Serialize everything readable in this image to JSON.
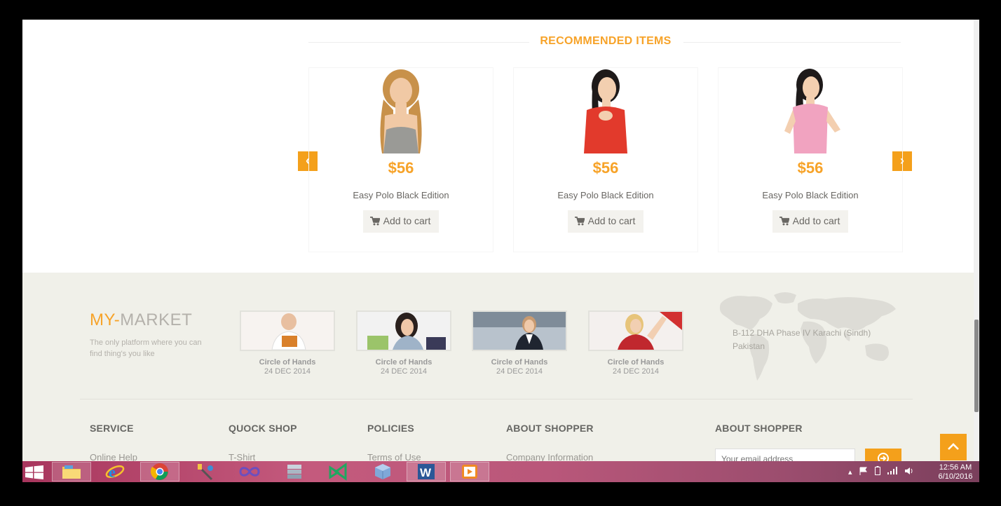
{
  "recommended": {
    "title": "RECOMMENDED ITEMS",
    "prev_label": "‹",
    "next_label": "›",
    "items": [
      {
        "price": "$56",
        "name": "Easy Polo Black Edition",
        "cart_label": "Add to cart",
        "dress_color": "#9a9a96"
      },
      {
        "price": "$56",
        "name": "Easy Polo Black Edition",
        "cart_label": "Add to cart",
        "dress_color": "#e23a2c"
      },
      {
        "price": "$56",
        "name": "Easy Polo Black Edition",
        "cart_label": "Add to cart",
        "dress_color": "#f1a3c0"
      }
    ]
  },
  "footer": {
    "logo_accent": "MY-",
    "logo_rest": "MARKET",
    "tagline": "The only platform where you can find thing's you like",
    "videos": [
      {
        "title": "Circle of Hands",
        "date": "24 DEC 2014"
      },
      {
        "title": "Circle of Hands",
        "date": "24 DEC 2014"
      },
      {
        "title": "Circle of Hands",
        "date": "24 DEC 2014"
      },
      {
        "title": "Circle of Hands",
        "date": "24 DEC 2014"
      }
    ],
    "address": "B-112 DHA Phase IV Karachi (Sindh) Pakistan",
    "columns": [
      {
        "heading": "SERVICE",
        "first_link": "Online Help"
      },
      {
        "heading": "QUOCK SHOP",
        "first_link": "T-Shirt"
      },
      {
        "heading": "POLICIES",
        "first_link": "Terms of Use"
      },
      {
        "heading": "ABOUT SHOPPER",
        "first_link": "Company Information"
      },
      {
        "heading": "ABOUT SHOPPER",
        "first_link": ""
      }
    ],
    "email_placeholder": "Your email address"
  },
  "taskbar": {
    "apps": [
      "file-explorer",
      "internet-explorer",
      "chrome",
      "paint",
      "visual-studio-infinity",
      "database-tool",
      "visual-studio",
      "virtualbox",
      "word",
      "media-player"
    ],
    "time": "12:56 AM",
    "date": "6/10/2016"
  },
  "colors": {
    "accent": "#f7a329",
    "button_orange": "#f4a01b",
    "footer_bg": "#f0f0e9"
  }
}
